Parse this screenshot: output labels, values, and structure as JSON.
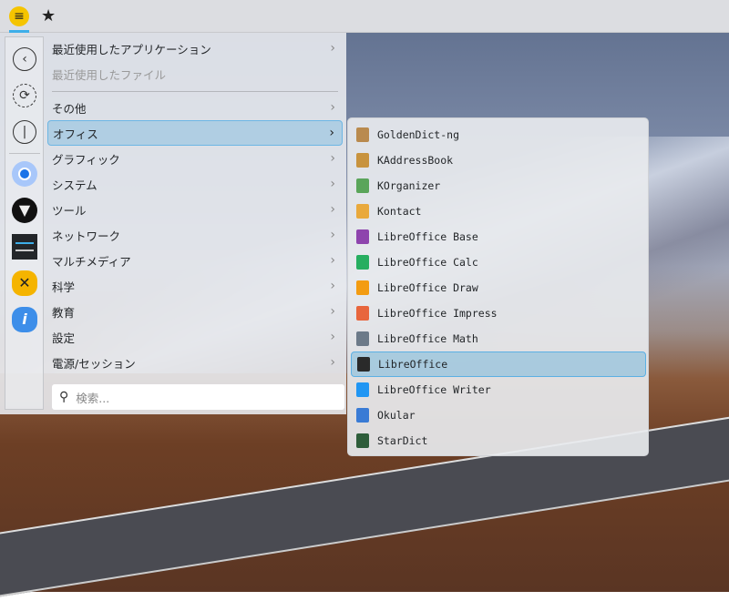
{
  "topbar": {
    "menu_icon": "hamburger-icon",
    "favorites_icon": "star-icon"
  },
  "sidebar": {
    "items": [
      {
        "name": "back",
        "icon": "‹"
      },
      {
        "name": "refresh",
        "icon": "⟳"
      },
      {
        "name": "power",
        "icon": "⏻"
      }
    ],
    "apps": [
      {
        "name": "chromium",
        "color": "#1a73e8"
      },
      {
        "name": "moth",
        "color": "#111111"
      },
      {
        "name": "settings",
        "color": "#232629"
      },
      {
        "name": "tools",
        "color": "#f5b400"
      },
      {
        "name": "info",
        "color": "#3d8ee9"
      }
    ]
  },
  "categories": [
    {
      "label": "最近使用したアプリケーション",
      "arrow": true
    },
    {
      "label": "最近使用したファイル",
      "arrow": false,
      "disabled": true
    },
    {
      "label": "その他",
      "arrow": true
    },
    {
      "label": "オフィス",
      "arrow": true,
      "selected": true
    },
    {
      "label": "グラフィック",
      "arrow": true
    },
    {
      "label": "システム",
      "arrow": true
    },
    {
      "label": "ツール",
      "arrow": true
    },
    {
      "label": "ネットワーク",
      "arrow": true
    },
    {
      "label": "マルチメディア",
      "arrow": true
    },
    {
      "label": "科学",
      "arrow": true
    },
    {
      "label": "教育",
      "arrow": true
    },
    {
      "label": "設定",
      "arrow": true
    },
    {
      "label": "電源/セッション",
      "arrow": true
    }
  ],
  "search": {
    "placeholder": "検索..."
  },
  "office_apps": [
    {
      "label": "GoldenDict-ng",
      "color": "#b98a4e"
    },
    {
      "label": "KAddressBook",
      "color": "#c8933e"
    },
    {
      "label": "KOrganizer",
      "color": "#5aa55a"
    },
    {
      "label": "Kontact",
      "color": "#e9a93c"
    },
    {
      "label": "LibreOffice Base",
      "color": "#8e44ad"
    },
    {
      "label": "LibreOffice Calc",
      "color": "#27ae60"
    },
    {
      "label": "LibreOffice Draw",
      "color": "#f39c12"
    },
    {
      "label": "LibreOffice Impress",
      "color": "#e8663d"
    },
    {
      "label": "LibreOffice Math",
      "color": "#6c7a89"
    },
    {
      "label": "LibreOffice",
      "color": "#2a2a2a",
      "selected": true
    },
    {
      "label": "LibreOffice Writer",
      "color": "#2196f3"
    },
    {
      "label": "Okular",
      "color": "#3a7bd5"
    },
    {
      "label": "StarDict",
      "color": "#2e5d3a"
    }
  ]
}
